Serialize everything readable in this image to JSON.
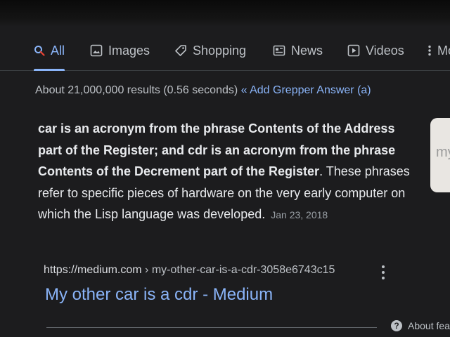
{
  "tabs": [
    {
      "label": "All",
      "icon": "search-icon",
      "active": true
    },
    {
      "label": "Images",
      "icon": "image-icon",
      "active": false
    },
    {
      "label": "Shopping",
      "icon": "tag-icon",
      "active": false
    },
    {
      "label": "News",
      "icon": "newspaper-icon",
      "active": false
    },
    {
      "label": "Videos",
      "icon": "play-icon",
      "active": false
    },
    {
      "label": "Mo",
      "icon": "more-vert-icon",
      "active": false
    }
  ],
  "results": {
    "stats": "About 21,000,000 results (0.56 seconds)",
    "grepper_link": "« Add Grepper Answer (a)"
  },
  "snippet": {
    "bold": "car is an acronym from the phrase Contents of the Address part of the Register; and cdr is an acronym from the phrase Contents of the Decrement part of the Register",
    "text": ". These phrases refer to specific pieces of hardware on the very early computer on which the Lisp language was developed.",
    "date": "Jan 23, 2018"
  },
  "side_card": {
    "text": "my"
  },
  "result": {
    "url_domain": "https://medium.com",
    "url_path": " › my-other-car-is-a-cdr-3058e6743c15",
    "title": "My other car is a cdr - Medium"
  },
  "footer": {
    "about_label": "About fea",
    "about_icon": "question-icon"
  },
  "colors": {
    "background": "#1c1c1e",
    "link": "#8ab4f8",
    "text": "#e8eaed"
  }
}
